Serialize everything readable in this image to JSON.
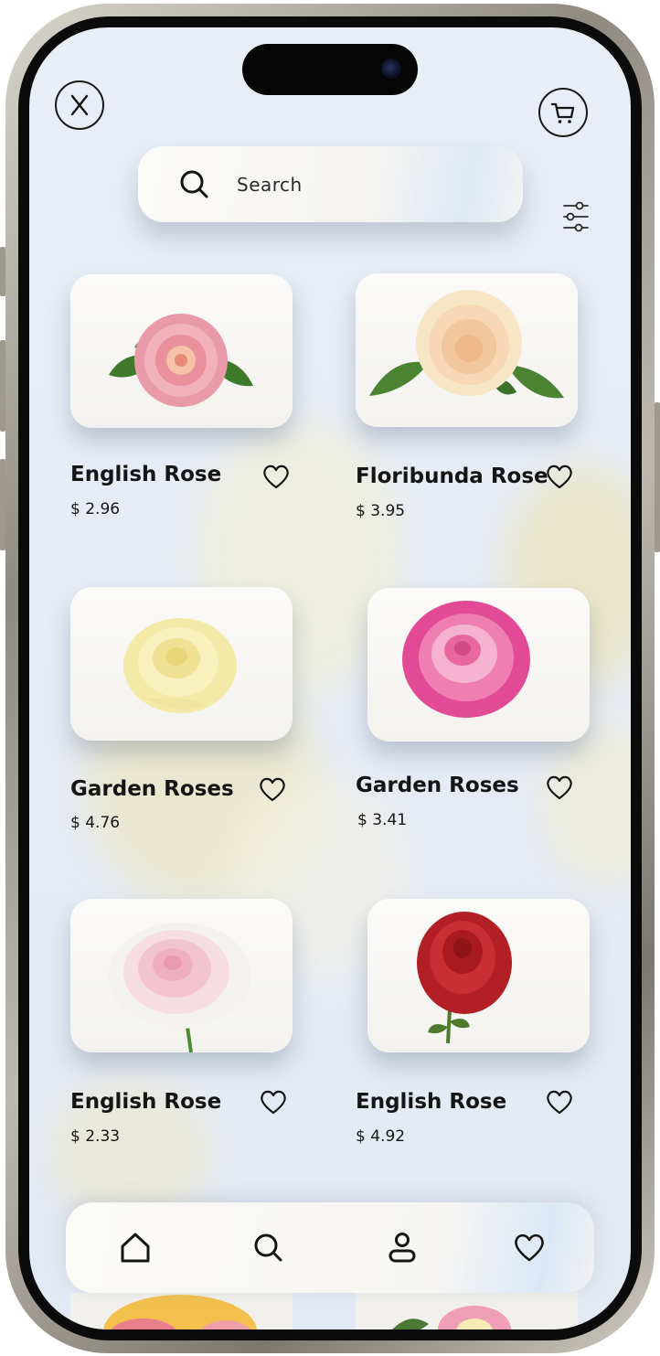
{
  "header": {
    "close_icon": "close-icon",
    "cart_icon": "cart-icon",
    "filter_icon": "filter-sliders-icon"
  },
  "search": {
    "placeholder": "Search",
    "icon": "search-icon"
  },
  "products": [
    {
      "name": "English Rose",
      "price": "$ 2.96",
      "color": "#e59aa8"
    },
    {
      "name": "Floribunda Rose",
      "price": "$ 3.95",
      "color": "#f5dcb6"
    },
    {
      "name": "Garden Roses",
      "price": "$ 4.76",
      "color": "#f4eaa8"
    },
    {
      "name": "Garden Roses",
      "price": "$ 3.41",
      "color": "#e24a95"
    },
    {
      "name": "English Rose",
      "price": "$ 2.33",
      "color": "#f2cfd8"
    },
    {
      "name": "English Rose",
      "price": "$ 4.92",
      "color": "#b21f24"
    }
  ],
  "bottom_nav": [
    {
      "id": "home",
      "icon": "home-icon"
    },
    {
      "id": "search",
      "icon": "search-icon"
    },
    {
      "id": "profile",
      "icon": "user-icon"
    },
    {
      "id": "favorites",
      "icon": "heart-icon"
    }
  ]
}
